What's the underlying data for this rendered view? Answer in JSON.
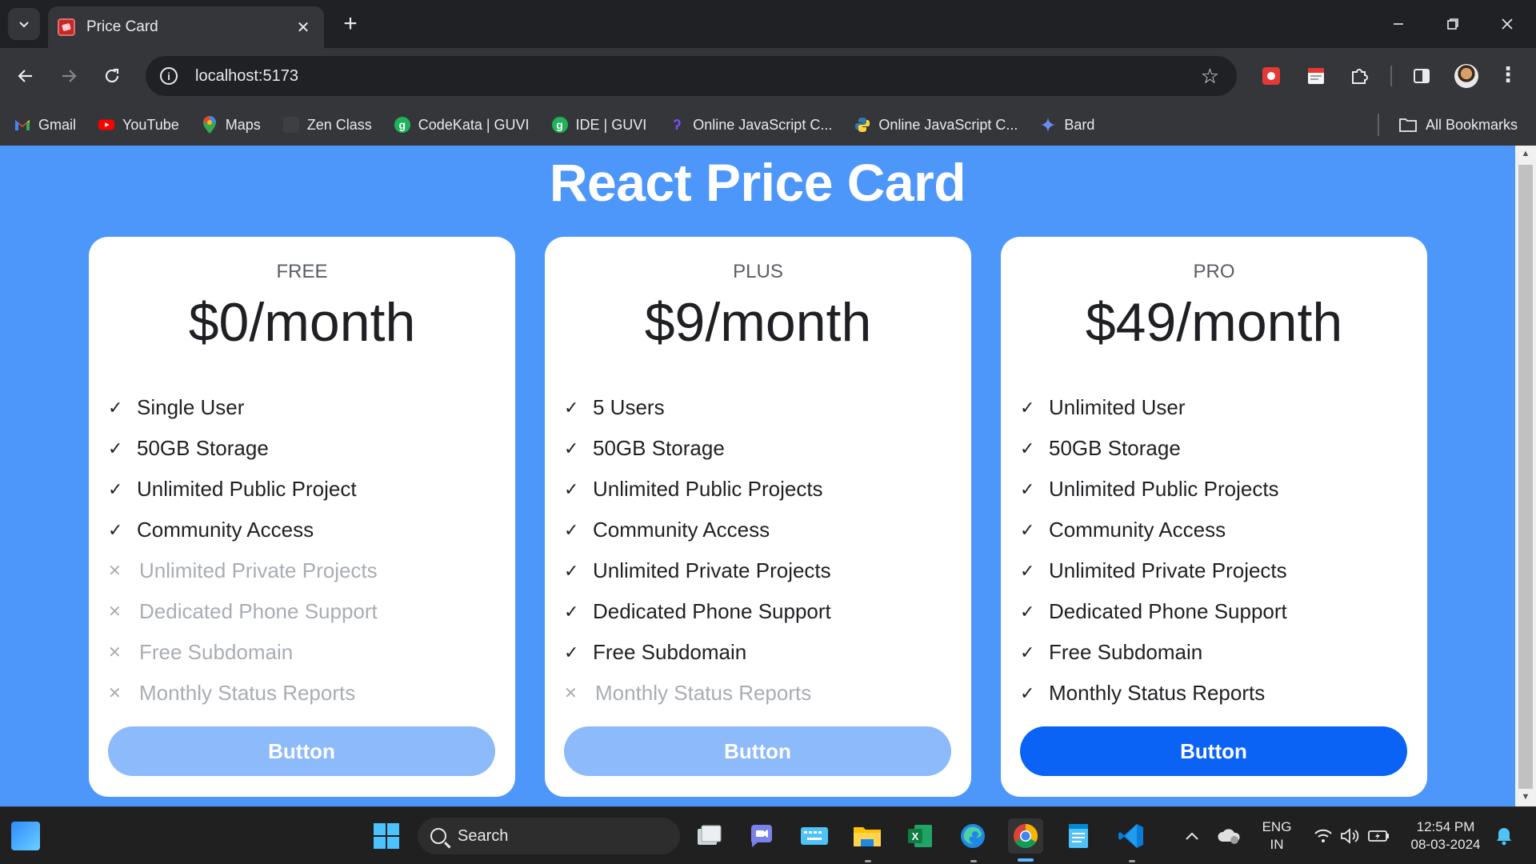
{
  "browser": {
    "tab_title": "Price Card",
    "url": "localhost:5173",
    "bookmarks": [
      {
        "label": "Gmail",
        "icon": "gmail-icon"
      },
      {
        "label": "YouTube",
        "icon": "youtube-icon"
      },
      {
        "label": "Maps",
        "icon": "maps-icon"
      },
      {
        "label": "Zen Class",
        "icon": "zen-class-icon"
      },
      {
        "label": "CodeKata | GUVI",
        "icon": "guvi-icon"
      },
      {
        "label": "IDE | GUVI",
        "icon": "guvi-icon"
      },
      {
        "label": "Online JavaScript C...",
        "icon": "programiz-icon"
      },
      {
        "label": "Online JavaScript C...",
        "icon": "python-icon"
      },
      {
        "label": "Bard",
        "icon": "bard-icon"
      }
    ],
    "all_bookmarks": "All Bookmarks"
  },
  "page": {
    "title": "React Price Card",
    "cards": [
      {
        "name": "FREE",
        "price": "$0/month",
        "button": "Button",
        "button_active": false,
        "features": [
          {
            "text": "Single User",
            "included": true
          },
          {
            "text": "50GB Storage",
            "included": true
          },
          {
            "text": "Unlimited Public Project",
            "included": true
          },
          {
            "text": "Community Access",
            "included": true
          },
          {
            "text": "Unlimited Private Projects",
            "included": false
          },
          {
            "text": "Dedicated Phone Support",
            "included": false
          },
          {
            "text": "Free Subdomain",
            "included": false
          },
          {
            "text": "Monthly Status Reports",
            "included": false
          }
        ]
      },
      {
        "name": "PLUS",
        "price": "$9/month",
        "button": "Button",
        "button_active": false,
        "features": [
          {
            "text": "5 Users",
            "included": true
          },
          {
            "text": "50GB Storage",
            "included": true
          },
          {
            "text": "Unlimited Public Projects",
            "included": true
          },
          {
            "text": "Community Access",
            "included": true
          },
          {
            "text": "Unlimited Private Projects",
            "included": true
          },
          {
            "text": "Dedicated Phone Support",
            "included": true
          },
          {
            "text": "Free Subdomain",
            "included": true
          },
          {
            "text": "Monthly Status Reports",
            "included": false
          }
        ]
      },
      {
        "name": "PRO",
        "price": "$49/month",
        "button": "Button",
        "button_active": true,
        "features": [
          {
            "text": "Unlimited User",
            "included": true
          },
          {
            "text": "50GB Storage",
            "included": true
          },
          {
            "text": "Unlimited Public Projects",
            "included": true
          },
          {
            "text": "Community Access",
            "included": true
          },
          {
            "text": "Unlimited Private Projects",
            "included": true
          },
          {
            "text": "Dedicated Phone Support",
            "included": true
          },
          {
            "text": "Free Subdomain",
            "included": true
          },
          {
            "text": "Monthly Status Reports",
            "included": true
          }
        ]
      }
    ]
  },
  "taskbar": {
    "search_placeholder": "Search",
    "language": "ENG",
    "region": "IN",
    "time": "12:54 PM",
    "date": "08-03-2024"
  },
  "colors": {
    "page_background": "#4d97fb",
    "button_active": "#0b63f6",
    "button_inactive": "#8dbafb"
  }
}
